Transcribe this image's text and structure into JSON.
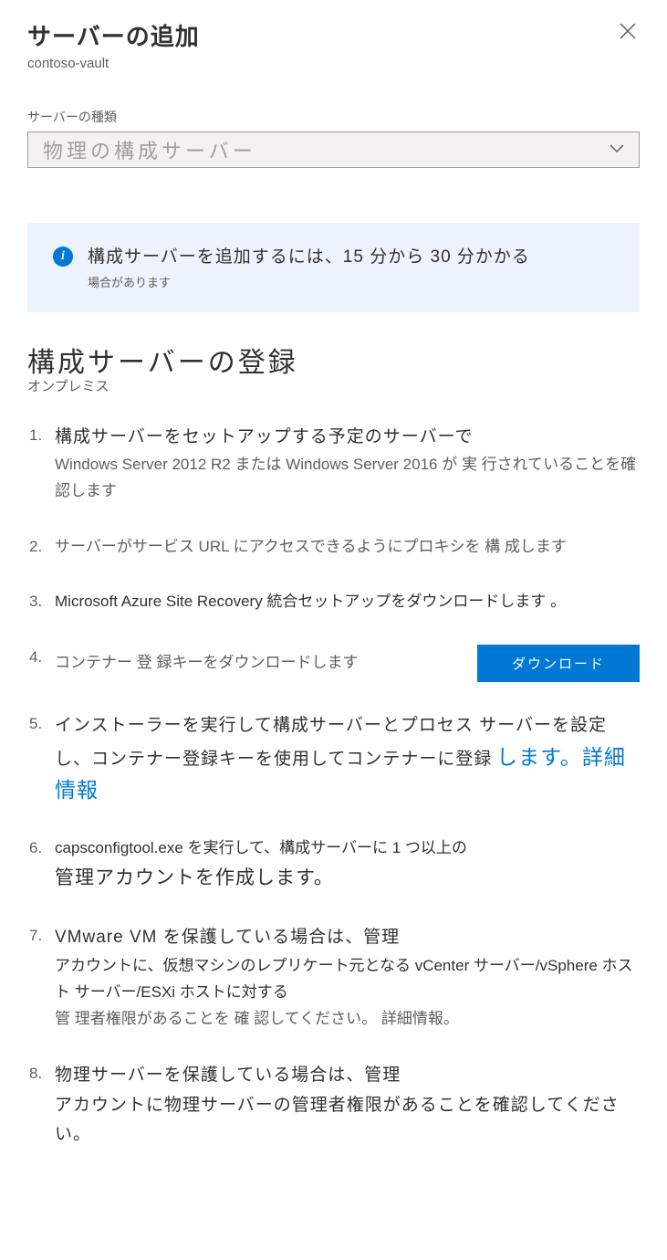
{
  "header": {
    "title": "サーバーの追加",
    "subtitle": "contoso-vault"
  },
  "serverType": {
    "label": "サーバーの種類",
    "selected": "物理の構成サーバー"
  },
  "infoBanner": {
    "main": "構成サーバーを追加するには、15 分から 30 分かかる",
    "sub": "場合があります"
  },
  "section": {
    "title": "構成サーバーの登録",
    "subtitle": "オンプレミス"
  },
  "steps": {
    "s1_a": "構成サーバーをセットアップする予定のサーバーで",
    "s1_b": "Windows Server 2012 R2 または Windows Server 2016 が 実 行されていることを確 認します",
    "s2": "サーバーがサービス URL にアクセスできるようにプロキシを 構 成します",
    "s3": "Microsoft Azure Site Recovery 統合セットアップをダウンロードします 。",
    "s4": "コンテナー 登 録キーをダウンロードします",
    "s4_btn": "ダウンロード",
    "s5_a": "インストーラーを実行して構成サーバーとプロセス サーバーを設定し、コンテナー登録キーを使用してコンテナーに登録",
    "s5_b": "します。詳細情報",
    "s6_a": "capsconfigtool.exe を実行して、構成サーバーに 1 つ以上の",
    "s6_b": "管理アカウントを作成します。",
    "s7_a": "VMware VM を保護している場合は、管理",
    "s7_b": "アカウントに、仮想マシンのレプリケート元となる vCenter サーバー/vSphere ホスト サーバー/ESXi ホストに対する",
    "s7_c": "管 理者権限があることを 確 認してください。 詳細情報。",
    "s8_a": "物理サーバーを保護している場合は、管理",
    "s8_b": "アカウントに物理サーバーの管理者権限があることを確認してください。"
  }
}
